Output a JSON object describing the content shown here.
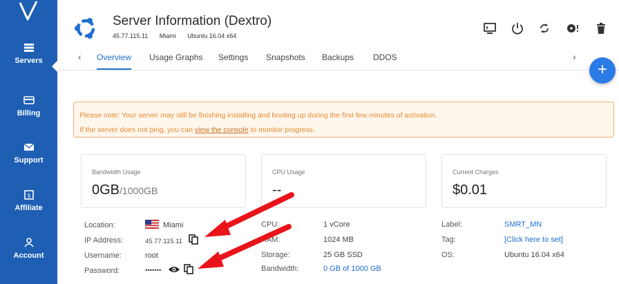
{
  "sidebar": {
    "logo": "vultr-logo-icon",
    "items": [
      {
        "label": "Servers",
        "icon": "server-stack-icon",
        "active": true
      },
      {
        "label": "Billing",
        "icon": "credit-card-icon"
      },
      {
        "label": "Support",
        "icon": "envelope-icon"
      },
      {
        "label": "Affiliate",
        "icon": "dollar-badge-icon"
      },
      {
        "label": "Account",
        "icon": "person-icon"
      }
    ]
  },
  "header": {
    "title": "Server Information (Dextro)",
    "ip": "45.77.115.11",
    "location": "Miami",
    "os": "Ubuntu 16.04 x64",
    "toolbar": [
      "console-icon",
      "power-icon",
      "restart-icon",
      "reinstall-icon",
      "trash-icon"
    ]
  },
  "tabs": [
    "Overview",
    "Usage Graphs",
    "Settings",
    "Snapshots",
    "Backups",
    "DDOS"
  ],
  "fab_label": "+",
  "notice": {
    "line1": "Please note: Your server may still be finishing installing and booting up during the first few minutes of activation.",
    "line2_pre": "If the server does not ping, you can ",
    "line2_link": "view the console",
    "line2_post": " to monitor progress."
  },
  "cards": {
    "bandwidth": {
      "label": "Bandwidth Usage",
      "value": "0GB",
      "unit": "/1000GB"
    },
    "cpu": {
      "label": "CPU Usage",
      "value": "--"
    },
    "charges": {
      "label": "Current Charges",
      "value": "$0.01"
    }
  },
  "details": {
    "location_label": "Location:",
    "location": "Miami",
    "ip_label": "IP Address:",
    "ip": "45.77.115.11",
    "username_label": "Username:",
    "username": "root",
    "password_label": "Password:",
    "password": "•••••••",
    "cpu_label": "CPU:",
    "cpu": "1 vCore",
    "ram_label": "RAM:",
    "ram": "1024 MB",
    "storage_label": "Storage:",
    "storage": "25 GB SSD",
    "bandwidth_label": "Bandwidth:",
    "bandwidth": "0 GB of 1000 GB",
    "label_label": "Label:",
    "label": "SMRT_MN",
    "tag_label": "Tag:",
    "tag": "[Click here to set]",
    "os_label": "OS:",
    "os": "Ubuntu 16.04 x64"
  },
  "colors": {
    "sidebar": "#1e5fb4",
    "accent": "#1e6fd0",
    "notice": "#e58a2d",
    "arrow": "#e8141a"
  }
}
